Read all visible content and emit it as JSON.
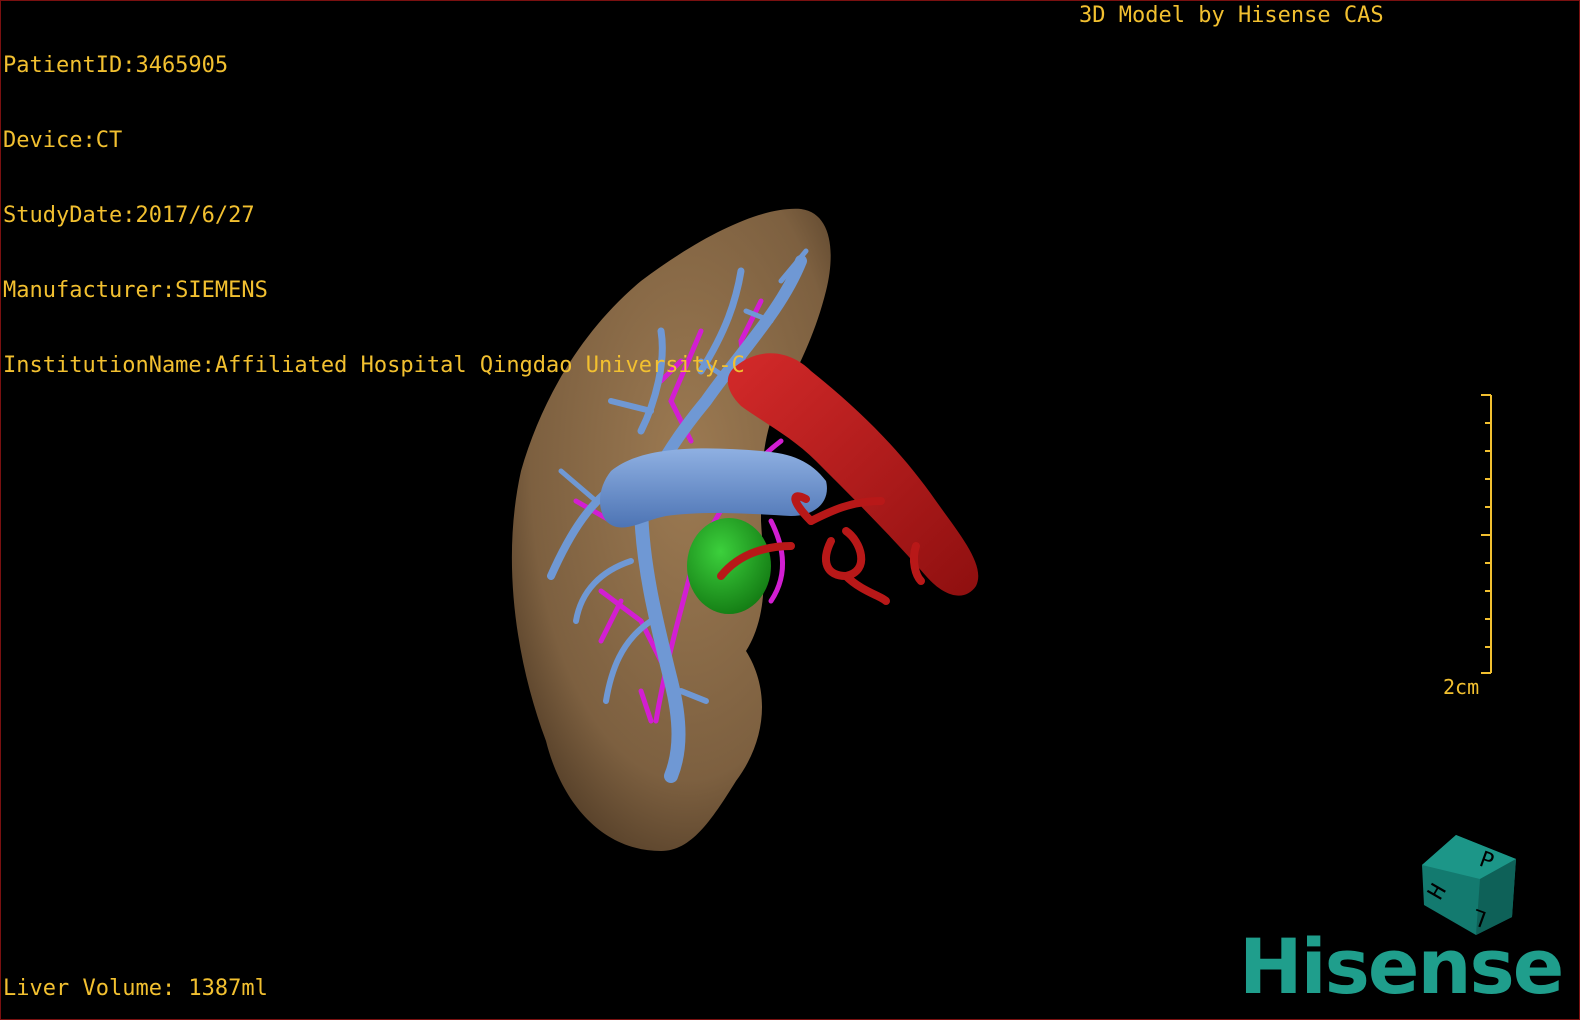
{
  "overlay": {
    "patient_id": "PatientID:3465905",
    "device": "Device:CT",
    "study_date": "StudyDate:2017/6/27",
    "manufacturer": "Manufacturer:SIEMENS",
    "institution": "InstitutionName:Affiliated Hospital Qingdao University-C",
    "credit": "3D Model by Hisense CAS",
    "liver_volume": "Liver Volume: 1387ml"
  },
  "scale": {
    "label": "2cm"
  },
  "orientation_cube": {
    "face_labels": [
      "P",
      "H",
      "L"
    ]
  },
  "logo": {
    "text": "Hisense"
  },
  "colors": {
    "overlay_text": "#f2c030",
    "liver": "#8a6a45",
    "portal_vein": "#6f98d4",
    "hepatic_artery": "#c81c1c",
    "bile_duct": "#d21ed2",
    "lesion": "#1fa01f",
    "brand": "#1f9e8c"
  },
  "icons": {
    "cube": "orientation-cube-icon",
    "scale": "ruler-icon"
  }
}
